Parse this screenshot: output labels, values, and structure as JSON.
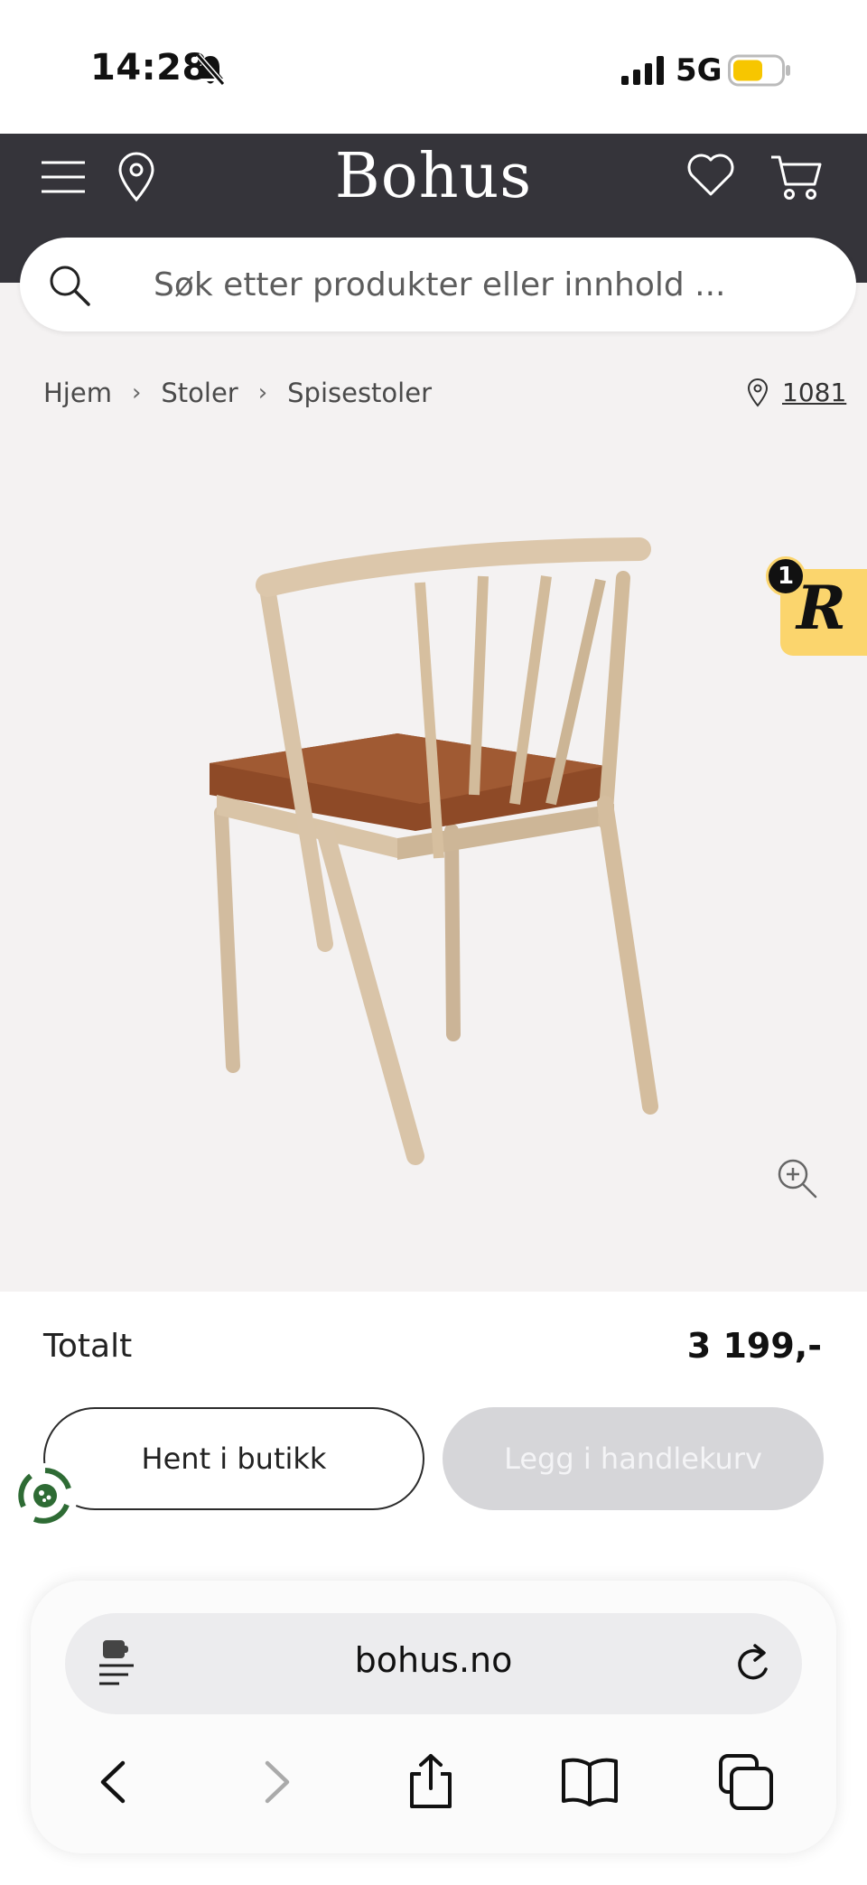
{
  "status_bar": {
    "time": "14:28",
    "network": "5G",
    "battery_color": "#f7c600"
  },
  "header": {
    "brand": "Bohus",
    "background": "#35343a"
  },
  "search": {
    "placeholder": "Søk etter produkter eller innhold ..."
  },
  "breadcrumb": {
    "items": [
      "Hjem",
      "Stoler",
      "Spisestoler"
    ],
    "store": "1081"
  },
  "badge": {
    "letter": "R",
    "count": "1",
    "color": "#fbd56d"
  },
  "purchase": {
    "total_label": "Totalt",
    "total_price": "3 199,-",
    "pickup_label": "Hent i butikk",
    "cart_label": "Legg i handlekurv"
  },
  "browser": {
    "url": "bohus.no"
  }
}
